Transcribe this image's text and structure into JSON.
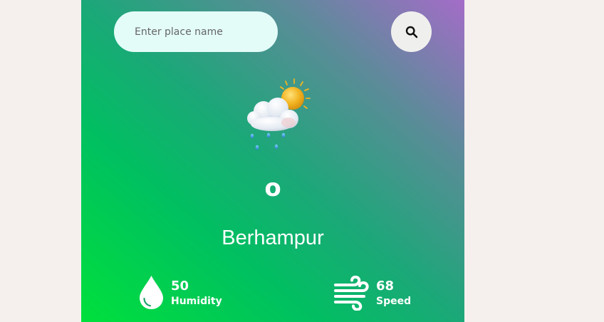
{
  "search": {
    "placeholder": "Enter place name",
    "value": "",
    "button_icon": "search-icon"
  },
  "weather": {
    "icon": "sun-cloud-rain-icon",
    "temperature": "o",
    "city": "Berhampur"
  },
  "humidity": {
    "icon": "water-drop-icon",
    "value": "50",
    "label": "Humidity"
  },
  "wind": {
    "icon": "wind-icon",
    "value": "68",
    "label": "Speed"
  },
  "colors": {
    "background": "#f5f0ee",
    "gradient_bottom_left": "#00e03c",
    "gradient_middle": "#1ba878",
    "gradient_top_right": "#a46cc8",
    "search_field": "#e3fcf8",
    "search_button": "#efefed",
    "text": "#ffffff"
  }
}
